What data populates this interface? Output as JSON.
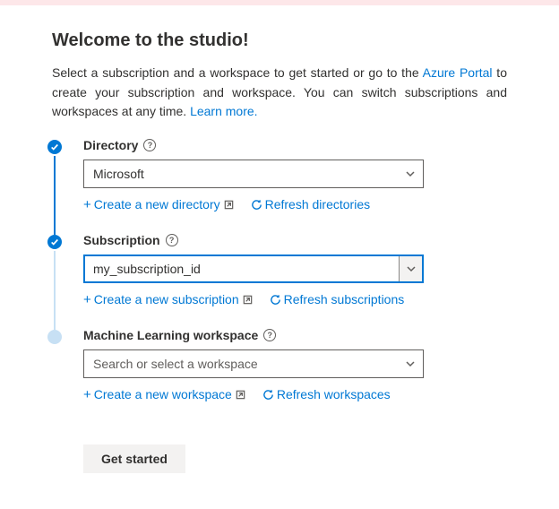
{
  "header": {
    "title": "Welcome to the studio!",
    "intro_pre": "Select a subscription and a workspace to get started or go to the ",
    "portal_link": "Azure Portal",
    "intro_mid": " to create your subscription and workspace. You can switch subscriptions and workspaces at any time. ",
    "learn_more": "Learn more."
  },
  "steps": {
    "directory": {
      "label": "Directory",
      "value": "Microsoft",
      "create": "Create a new directory",
      "refresh": "Refresh directories"
    },
    "subscription": {
      "label": "Subscription",
      "value": "my_subscription_id",
      "create": "Create a new subscription",
      "refresh": "Refresh subscriptions"
    },
    "workspace": {
      "label": "Machine Learning workspace",
      "placeholder": "Search or select a workspace",
      "create": "Create a new workspace",
      "refresh": "Refresh workspaces"
    }
  },
  "footer": {
    "get_started": "Get started"
  }
}
